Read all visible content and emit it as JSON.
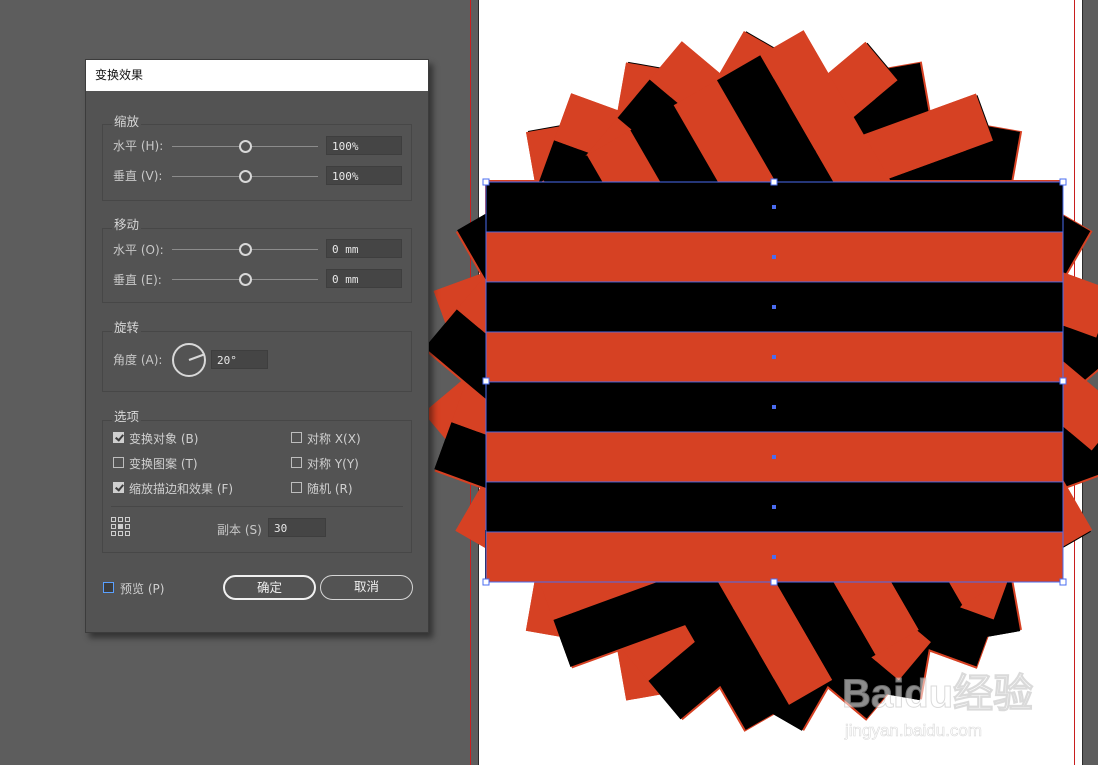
{
  "dialog": {
    "title": "变换效果",
    "scale": {
      "legend": "缩放",
      "horizontal_label": "水平 (H):",
      "horizontal_value": "100%",
      "vertical_label": "垂直 (V):",
      "vertical_value": "100%"
    },
    "move": {
      "legend": "移动",
      "horizontal_label": "水平 (O):",
      "horizontal_value": "0 mm",
      "vertical_label": "垂直 (E):",
      "vertical_value": "0 mm"
    },
    "rotate": {
      "legend": "旋转",
      "angle_label": "角度 (A):",
      "angle_value": "20°"
    },
    "options": {
      "legend": "选项",
      "transform_objects": "变换对象 (B)",
      "transform_patterns": "变换图案 (T)",
      "scale_strokes_effects": "缩放描边和效果 (F)",
      "reflect_x": "对称 X(X)",
      "reflect_y": "对称 Y(Y)",
      "random": "随机 (R)",
      "copies_label": "副本 (S)",
      "copies_value": "30"
    },
    "preview_label": "预览 (P)",
    "ok_label": "确定",
    "cancel_label": "取消"
  },
  "state": {
    "transform_objects_checked": true,
    "transform_patterns_checked": false,
    "scale_strokes_effects_checked": true,
    "reflect_x_checked": false,
    "reflect_y_checked": false,
    "random_checked": false,
    "preview_checked": false
  },
  "colors": {
    "red_stripe": "#d64123",
    "black_stripe": "#000000",
    "selection": "#4a6cf0",
    "guide": "#cc2020"
  },
  "watermark": {
    "brand": "Baidu经验",
    "url": "jingyan.baidu.com"
  }
}
